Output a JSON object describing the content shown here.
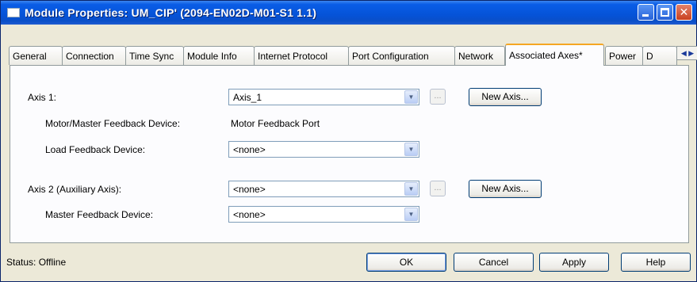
{
  "window": {
    "title": "Module Properties: UM_CIP'  (2094-EN02D-M01-S1 1.1)"
  },
  "tabs": [
    {
      "label": "General"
    },
    {
      "label": "Connection"
    },
    {
      "label": "Time Sync"
    },
    {
      "label": "Module Info"
    },
    {
      "label": "Internet Protocol"
    },
    {
      "label": "Port Configuration"
    },
    {
      "label": "Network"
    },
    {
      "label": "Associated Axes*",
      "active": true
    },
    {
      "label": "Power"
    },
    {
      "label": "D"
    }
  ],
  "tab_scroll": {
    "left": "◀",
    "right": "▶"
  },
  "form": {
    "axis1": {
      "label": "Axis 1:",
      "value": "Axis_1",
      "browse": "...",
      "new_axis": "New Axis..."
    },
    "motor_feedback": {
      "label": "Motor/Master Feedback Device:",
      "value": "Motor Feedback Port"
    },
    "load_feedback": {
      "label": "Load Feedback Device:",
      "value": "<none>"
    },
    "axis2": {
      "label": "Axis 2  (Auxiliary Axis):",
      "value": "<none>",
      "browse": "...",
      "new_axis": "New Axis..."
    },
    "master_feedback": {
      "label": "Master Feedback Device:",
      "value": "<none>"
    }
  },
  "footer": {
    "status": "Status:  Offline",
    "ok": "OK",
    "cancel": "Cancel",
    "apply": "Apply",
    "help": "Help"
  },
  "icons": {
    "dropdown": "chevron-down-icon",
    "minimize": "minimize-icon",
    "maximize": "maximize-icon",
    "close": "close-icon"
  },
  "colors": {
    "titlebar": "#0553d8",
    "active_tab_accent": "#f5a623",
    "dialog_bg": "#ece9d8"
  }
}
